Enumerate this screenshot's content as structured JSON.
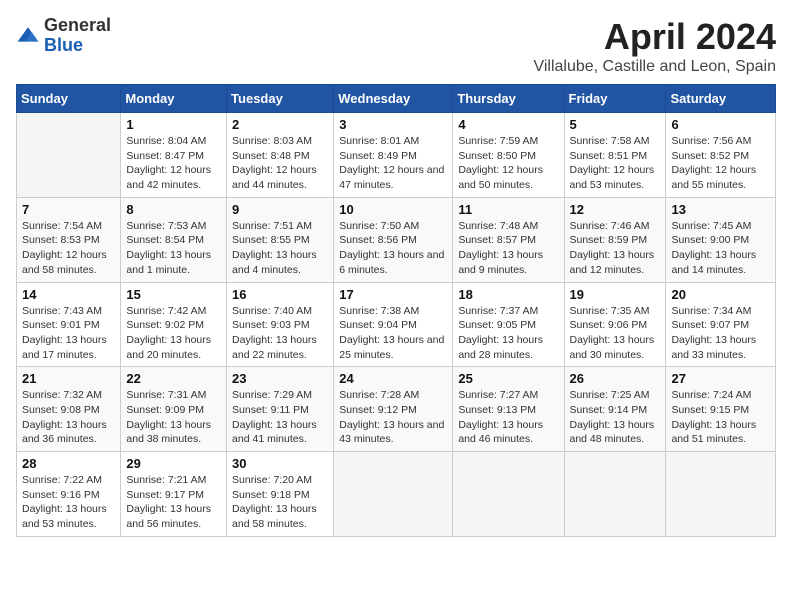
{
  "logo": {
    "general": "General",
    "blue": "Blue"
  },
  "title": "April 2024",
  "subtitle": "Villalube, Castille and Leon, Spain",
  "weekdays": [
    "Sunday",
    "Monday",
    "Tuesday",
    "Wednesday",
    "Thursday",
    "Friday",
    "Saturday"
  ],
  "weeks": [
    [
      {
        "num": "",
        "sunrise": "",
        "sunset": "",
        "daylight": ""
      },
      {
        "num": "1",
        "sunrise": "Sunrise: 8:04 AM",
        "sunset": "Sunset: 8:47 PM",
        "daylight": "Daylight: 12 hours and 42 minutes."
      },
      {
        "num": "2",
        "sunrise": "Sunrise: 8:03 AM",
        "sunset": "Sunset: 8:48 PM",
        "daylight": "Daylight: 12 hours and 44 minutes."
      },
      {
        "num": "3",
        "sunrise": "Sunrise: 8:01 AM",
        "sunset": "Sunset: 8:49 PM",
        "daylight": "Daylight: 12 hours and 47 minutes."
      },
      {
        "num": "4",
        "sunrise": "Sunrise: 7:59 AM",
        "sunset": "Sunset: 8:50 PM",
        "daylight": "Daylight: 12 hours and 50 minutes."
      },
      {
        "num": "5",
        "sunrise": "Sunrise: 7:58 AM",
        "sunset": "Sunset: 8:51 PM",
        "daylight": "Daylight: 12 hours and 53 minutes."
      },
      {
        "num": "6",
        "sunrise": "Sunrise: 7:56 AM",
        "sunset": "Sunset: 8:52 PM",
        "daylight": "Daylight: 12 hours and 55 minutes."
      }
    ],
    [
      {
        "num": "7",
        "sunrise": "Sunrise: 7:54 AM",
        "sunset": "Sunset: 8:53 PM",
        "daylight": "Daylight: 12 hours and 58 minutes."
      },
      {
        "num": "8",
        "sunrise": "Sunrise: 7:53 AM",
        "sunset": "Sunset: 8:54 PM",
        "daylight": "Daylight: 13 hours and 1 minute."
      },
      {
        "num": "9",
        "sunrise": "Sunrise: 7:51 AM",
        "sunset": "Sunset: 8:55 PM",
        "daylight": "Daylight: 13 hours and 4 minutes."
      },
      {
        "num": "10",
        "sunrise": "Sunrise: 7:50 AM",
        "sunset": "Sunset: 8:56 PM",
        "daylight": "Daylight: 13 hours and 6 minutes."
      },
      {
        "num": "11",
        "sunrise": "Sunrise: 7:48 AM",
        "sunset": "Sunset: 8:57 PM",
        "daylight": "Daylight: 13 hours and 9 minutes."
      },
      {
        "num": "12",
        "sunrise": "Sunrise: 7:46 AM",
        "sunset": "Sunset: 8:59 PM",
        "daylight": "Daylight: 13 hours and 12 minutes."
      },
      {
        "num": "13",
        "sunrise": "Sunrise: 7:45 AM",
        "sunset": "Sunset: 9:00 PM",
        "daylight": "Daylight: 13 hours and 14 minutes."
      }
    ],
    [
      {
        "num": "14",
        "sunrise": "Sunrise: 7:43 AM",
        "sunset": "Sunset: 9:01 PM",
        "daylight": "Daylight: 13 hours and 17 minutes."
      },
      {
        "num": "15",
        "sunrise": "Sunrise: 7:42 AM",
        "sunset": "Sunset: 9:02 PM",
        "daylight": "Daylight: 13 hours and 20 minutes."
      },
      {
        "num": "16",
        "sunrise": "Sunrise: 7:40 AM",
        "sunset": "Sunset: 9:03 PM",
        "daylight": "Daylight: 13 hours and 22 minutes."
      },
      {
        "num": "17",
        "sunrise": "Sunrise: 7:38 AM",
        "sunset": "Sunset: 9:04 PM",
        "daylight": "Daylight: 13 hours and 25 minutes."
      },
      {
        "num": "18",
        "sunrise": "Sunrise: 7:37 AM",
        "sunset": "Sunset: 9:05 PM",
        "daylight": "Daylight: 13 hours and 28 minutes."
      },
      {
        "num": "19",
        "sunrise": "Sunrise: 7:35 AM",
        "sunset": "Sunset: 9:06 PM",
        "daylight": "Daylight: 13 hours and 30 minutes."
      },
      {
        "num": "20",
        "sunrise": "Sunrise: 7:34 AM",
        "sunset": "Sunset: 9:07 PM",
        "daylight": "Daylight: 13 hours and 33 minutes."
      }
    ],
    [
      {
        "num": "21",
        "sunrise": "Sunrise: 7:32 AM",
        "sunset": "Sunset: 9:08 PM",
        "daylight": "Daylight: 13 hours and 36 minutes."
      },
      {
        "num": "22",
        "sunrise": "Sunrise: 7:31 AM",
        "sunset": "Sunset: 9:09 PM",
        "daylight": "Daylight: 13 hours and 38 minutes."
      },
      {
        "num": "23",
        "sunrise": "Sunrise: 7:29 AM",
        "sunset": "Sunset: 9:11 PM",
        "daylight": "Daylight: 13 hours and 41 minutes."
      },
      {
        "num": "24",
        "sunrise": "Sunrise: 7:28 AM",
        "sunset": "Sunset: 9:12 PM",
        "daylight": "Daylight: 13 hours and 43 minutes."
      },
      {
        "num": "25",
        "sunrise": "Sunrise: 7:27 AM",
        "sunset": "Sunset: 9:13 PM",
        "daylight": "Daylight: 13 hours and 46 minutes."
      },
      {
        "num": "26",
        "sunrise": "Sunrise: 7:25 AM",
        "sunset": "Sunset: 9:14 PM",
        "daylight": "Daylight: 13 hours and 48 minutes."
      },
      {
        "num": "27",
        "sunrise": "Sunrise: 7:24 AM",
        "sunset": "Sunset: 9:15 PM",
        "daylight": "Daylight: 13 hours and 51 minutes."
      }
    ],
    [
      {
        "num": "28",
        "sunrise": "Sunrise: 7:22 AM",
        "sunset": "Sunset: 9:16 PM",
        "daylight": "Daylight: 13 hours and 53 minutes."
      },
      {
        "num": "29",
        "sunrise": "Sunrise: 7:21 AM",
        "sunset": "Sunset: 9:17 PM",
        "daylight": "Daylight: 13 hours and 56 minutes."
      },
      {
        "num": "30",
        "sunrise": "Sunrise: 7:20 AM",
        "sunset": "Sunset: 9:18 PM",
        "daylight": "Daylight: 13 hours and 58 minutes."
      },
      {
        "num": "",
        "sunrise": "",
        "sunset": "",
        "daylight": ""
      },
      {
        "num": "",
        "sunrise": "",
        "sunset": "",
        "daylight": ""
      },
      {
        "num": "",
        "sunrise": "",
        "sunset": "",
        "daylight": ""
      },
      {
        "num": "",
        "sunrise": "",
        "sunset": "",
        "daylight": ""
      }
    ]
  ]
}
